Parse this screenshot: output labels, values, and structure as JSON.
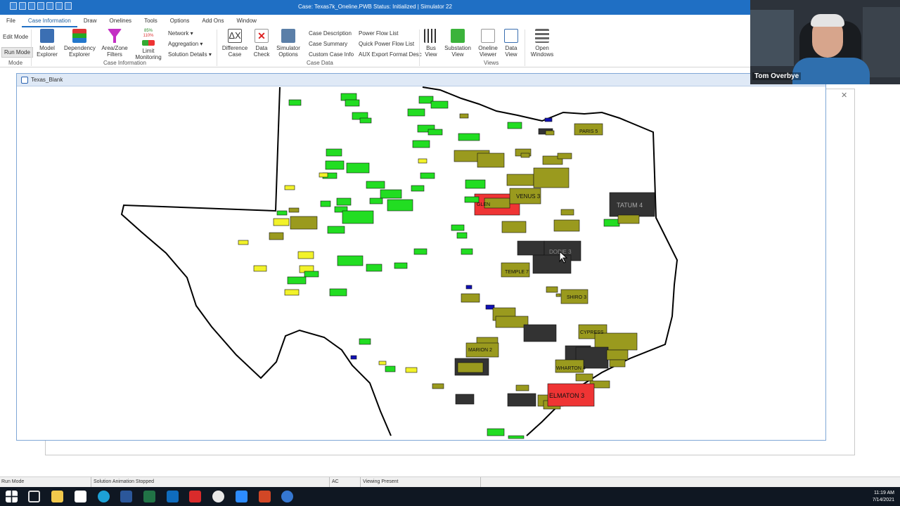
{
  "titlebar": {
    "title": "Case: Texas7k_Oneline.PWB  Status: Initialized | Simulator 22"
  },
  "menu": [
    {
      "label": "File",
      "active": false
    },
    {
      "label": "Case Information",
      "active": true
    },
    {
      "label": "Draw",
      "active": false
    },
    {
      "label": "Onelines",
      "active": false
    },
    {
      "label": "Tools",
      "active": false
    },
    {
      "label": "Options",
      "active": false
    },
    {
      "label": "Add Ons",
      "active": false
    },
    {
      "label": "Window",
      "active": false
    }
  ],
  "ribbon": {
    "mode_group": {
      "edit_mode": "Edit Mode",
      "run_mode": "Run Mode",
      "label": "Mode"
    },
    "case_info_group": {
      "label": "Case Information",
      "model_explorer": "Model\nExplorer",
      "dependency_explorer": "Dependency\nExplorer",
      "area_zone_filters": "Area/Zone\nFilters",
      "limit_monitoring": "Limit\nMonitoring",
      "limit_pct_top": "85%",
      "limit_pct_bottom": "110%",
      "network": "Network",
      "aggregation": "Aggregation",
      "solution_details": "Solution Details"
    },
    "case_data_group": {
      "label": "Case Data",
      "difference_case": "Difference\nCase",
      "data_check": "Data\nCheck",
      "simulator_options": "Simulator\nOptions",
      "case_description": "Case Description",
      "case_summary": "Case Summary",
      "custom_case_info": "Custom Case Info",
      "power_flow_list": "Power Flow List",
      "quick_power_flow_list": "Quick Power Flow List",
      "aux_export_format_desc": "AUX Export Format Desc"
    },
    "views_group": {
      "label": "Views",
      "bus_view": "Bus\nView",
      "substation_view": "Substation\nView",
      "oneline_viewer": "Oneline\nViewer",
      "data_view": "Data\nView",
      "open_windows": "Open\nWindows"
    }
  },
  "oneline_window": {
    "title": "Texas_Blank"
  },
  "webcam": {
    "name": "Tom Overbye"
  },
  "status": {
    "mode": "Run Mode",
    "animation": "Solution Animation Stopped",
    "ac": "AC",
    "viewing": "Viewing Present"
  },
  "taskbar": {
    "time": "11:19 AM",
    "date": "7/14/2021"
  },
  "colors": {
    "titlebar": "#1f6fc4",
    "bus_green": "#22dd22",
    "bus_olive": "#9a9a1e",
    "bus_yellow": "#f2f22a",
    "bus_red": "#ef3434",
    "bus_dark": "#333333",
    "bus_blue": "#1010b4"
  },
  "map": {
    "labels": [
      {
        "text": "PARIS 5"
      },
      {
        "text": "VENUS 3"
      },
      {
        "text": "TATUM 4"
      },
      {
        "text": "DOBIE 3"
      },
      {
        "text": "TEMPLE 7"
      },
      {
        "text": "SHIRO 3"
      },
      {
        "text": "MARION 2"
      },
      {
        "text": "WHARTON 4"
      },
      {
        "text": "ELMATON 3"
      },
      {
        "text": "GLEN"
      },
      {
        "text": "CYPRESS"
      }
    ]
  }
}
